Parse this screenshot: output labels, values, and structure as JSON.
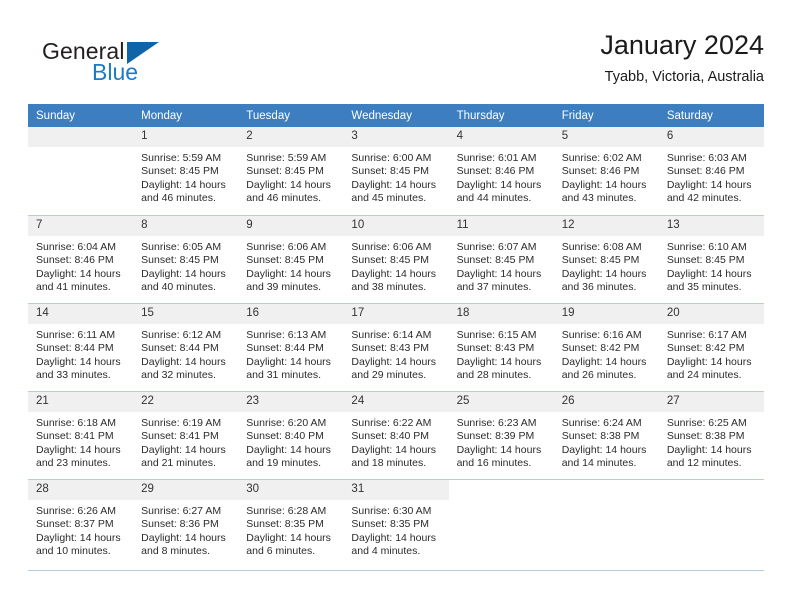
{
  "brand": {
    "name_part1": "General",
    "name_part2": "Blue",
    "logo_color": "#1064a8",
    "accent_color": "#2079c3"
  },
  "header": {
    "title": "January 2024",
    "location": "Tyabb, Victoria, Australia"
  },
  "theme": {
    "header_row_bg": "#3c7ebf",
    "daynum_bg": "#f0f0f0",
    "grid_line": "#b9cde2"
  },
  "weekday_headers": [
    "Sunday",
    "Monday",
    "Tuesday",
    "Wednesday",
    "Thursday",
    "Friday",
    "Saturday"
  ],
  "weeks": [
    [
      {
        "day": "",
        "empty": true,
        "sunrise": "",
        "sunset": "",
        "daylight1": "",
        "daylight2": ""
      },
      {
        "day": "1",
        "sunrise": "Sunrise: 5:59 AM",
        "sunset": "Sunset: 8:45 PM",
        "daylight1": "Daylight: 14 hours",
        "daylight2": "and 46 minutes."
      },
      {
        "day": "2",
        "sunrise": "Sunrise: 5:59 AM",
        "sunset": "Sunset: 8:45 PM",
        "daylight1": "Daylight: 14 hours",
        "daylight2": "and 46 minutes."
      },
      {
        "day": "3",
        "sunrise": "Sunrise: 6:00 AM",
        "sunset": "Sunset: 8:45 PM",
        "daylight1": "Daylight: 14 hours",
        "daylight2": "and 45 minutes."
      },
      {
        "day": "4",
        "sunrise": "Sunrise: 6:01 AM",
        "sunset": "Sunset: 8:46 PM",
        "daylight1": "Daylight: 14 hours",
        "daylight2": "and 44 minutes."
      },
      {
        "day": "5",
        "sunrise": "Sunrise: 6:02 AM",
        "sunset": "Sunset: 8:46 PM",
        "daylight1": "Daylight: 14 hours",
        "daylight2": "and 43 minutes."
      },
      {
        "day": "6",
        "sunrise": "Sunrise: 6:03 AM",
        "sunset": "Sunset: 8:46 PM",
        "daylight1": "Daylight: 14 hours",
        "daylight2": "and 42 minutes."
      }
    ],
    [
      {
        "day": "7",
        "sunrise": "Sunrise: 6:04 AM",
        "sunset": "Sunset: 8:46 PM",
        "daylight1": "Daylight: 14 hours",
        "daylight2": "and 41 minutes."
      },
      {
        "day": "8",
        "sunrise": "Sunrise: 6:05 AM",
        "sunset": "Sunset: 8:45 PM",
        "daylight1": "Daylight: 14 hours",
        "daylight2": "and 40 minutes."
      },
      {
        "day": "9",
        "sunrise": "Sunrise: 6:06 AM",
        "sunset": "Sunset: 8:45 PM",
        "daylight1": "Daylight: 14 hours",
        "daylight2": "and 39 minutes."
      },
      {
        "day": "10",
        "sunrise": "Sunrise: 6:06 AM",
        "sunset": "Sunset: 8:45 PM",
        "daylight1": "Daylight: 14 hours",
        "daylight2": "and 38 minutes."
      },
      {
        "day": "11",
        "sunrise": "Sunrise: 6:07 AM",
        "sunset": "Sunset: 8:45 PM",
        "daylight1": "Daylight: 14 hours",
        "daylight2": "and 37 minutes."
      },
      {
        "day": "12",
        "sunrise": "Sunrise: 6:08 AM",
        "sunset": "Sunset: 8:45 PM",
        "daylight1": "Daylight: 14 hours",
        "daylight2": "and 36 minutes."
      },
      {
        "day": "13",
        "sunrise": "Sunrise: 6:10 AM",
        "sunset": "Sunset: 8:45 PM",
        "daylight1": "Daylight: 14 hours",
        "daylight2": "and 35 minutes."
      }
    ],
    [
      {
        "day": "14",
        "sunrise": "Sunrise: 6:11 AM",
        "sunset": "Sunset: 8:44 PM",
        "daylight1": "Daylight: 14 hours",
        "daylight2": "and 33 minutes."
      },
      {
        "day": "15",
        "sunrise": "Sunrise: 6:12 AM",
        "sunset": "Sunset: 8:44 PM",
        "daylight1": "Daylight: 14 hours",
        "daylight2": "and 32 minutes."
      },
      {
        "day": "16",
        "sunrise": "Sunrise: 6:13 AM",
        "sunset": "Sunset: 8:44 PM",
        "daylight1": "Daylight: 14 hours",
        "daylight2": "and 31 minutes."
      },
      {
        "day": "17",
        "sunrise": "Sunrise: 6:14 AM",
        "sunset": "Sunset: 8:43 PM",
        "daylight1": "Daylight: 14 hours",
        "daylight2": "and 29 minutes."
      },
      {
        "day": "18",
        "sunrise": "Sunrise: 6:15 AM",
        "sunset": "Sunset: 8:43 PM",
        "daylight1": "Daylight: 14 hours",
        "daylight2": "and 28 minutes."
      },
      {
        "day": "19",
        "sunrise": "Sunrise: 6:16 AM",
        "sunset": "Sunset: 8:42 PM",
        "daylight1": "Daylight: 14 hours",
        "daylight2": "and 26 minutes."
      },
      {
        "day": "20",
        "sunrise": "Sunrise: 6:17 AM",
        "sunset": "Sunset: 8:42 PM",
        "daylight1": "Daylight: 14 hours",
        "daylight2": "and 24 minutes."
      }
    ],
    [
      {
        "day": "21",
        "sunrise": "Sunrise: 6:18 AM",
        "sunset": "Sunset: 8:41 PM",
        "daylight1": "Daylight: 14 hours",
        "daylight2": "and 23 minutes."
      },
      {
        "day": "22",
        "sunrise": "Sunrise: 6:19 AM",
        "sunset": "Sunset: 8:41 PM",
        "daylight1": "Daylight: 14 hours",
        "daylight2": "and 21 minutes."
      },
      {
        "day": "23",
        "sunrise": "Sunrise: 6:20 AM",
        "sunset": "Sunset: 8:40 PM",
        "daylight1": "Daylight: 14 hours",
        "daylight2": "and 19 minutes."
      },
      {
        "day": "24",
        "sunrise": "Sunrise: 6:22 AM",
        "sunset": "Sunset: 8:40 PM",
        "daylight1": "Daylight: 14 hours",
        "daylight2": "and 18 minutes."
      },
      {
        "day": "25",
        "sunrise": "Sunrise: 6:23 AM",
        "sunset": "Sunset: 8:39 PM",
        "daylight1": "Daylight: 14 hours",
        "daylight2": "and 16 minutes."
      },
      {
        "day": "26",
        "sunrise": "Sunrise: 6:24 AM",
        "sunset": "Sunset: 8:38 PM",
        "daylight1": "Daylight: 14 hours",
        "daylight2": "and 14 minutes."
      },
      {
        "day": "27",
        "sunrise": "Sunrise: 6:25 AM",
        "sunset": "Sunset: 8:38 PM",
        "daylight1": "Daylight: 14 hours",
        "daylight2": "and 12 minutes."
      }
    ],
    [
      {
        "day": "28",
        "sunrise": "Sunrise: 6:26 AM",
        "sunset": "Sunset: 8:37 PM",
        "daylight1": "Daylight: 14 hours",
        "daylight2": "and 10 minutes."
      },
      {
        "day": "29",
        "sunrise": "Sunrise: 6:27 AM",
        "sunset": "Sunset: 8:36 PM",
        "daylight1": "Daylight: 14 hours",
        "daylight2": "and 8 minutes."
      },
      {
        "day": "30",
        "sunrise": "Sunrise: 6:28 AM",
        "sunset": "Sunset: 8:35 PM",
        "daylight1": "Daylight: 14 hours",
        "daylight2": "and 6 minutes."
      },
      {
        "day": "31",
        "sunrise": "Sunrise: 6:30 AM",
        "sunset": "Sunset: 8:35 PM",
        "daylight1": "Daylight: 14 hours",
        "daylight2": "and 4 minutes."
      },
      {
        "day": "",
        "blank": true,
        "sunrise": "",
        "sunset": "",
        "daylight1": "",
        "daylight2": ""
      },
      {
        "day": "",
        "blank": true,
        "sunrise": "",
        "sunset": "",
        "daylight1": "",
        "daylight2": ""
      },
      {
        "day": "",
        "blank": true,
        "sunrise": "",
        "sunset": "",
        "daylight1": "",
        "daylight2": ""
      }
    ]
  ]
}
